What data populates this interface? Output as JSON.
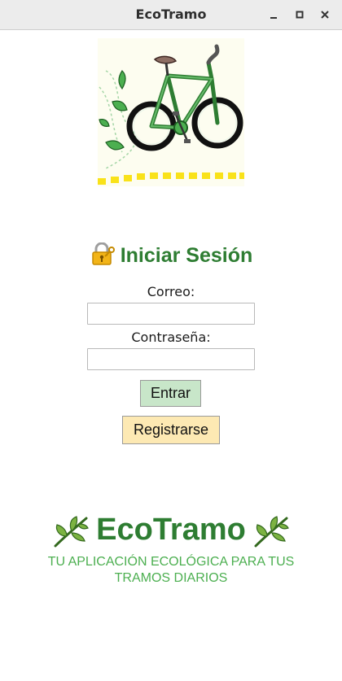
{
  "window": {
    "title": "EcoTramo",
    "controls": [
      "minimize-icon",
      "maximize-icon",
      "close-icon"
    ]
  },
  "login": {
    "icon": "lock-with-key-icon",
    "title": "Iniciar Sesión",
    "email_label": "Correo:",
    "email_value": "",
    "password_label": "Contraseña:",
    "password_value": "",
    "enter_label": "Entrar",
    "register_label": "Registrarse"
  },
  "brand": {
    "name": "EcoTramo",
    "icon": "herb-icon",
    "tagline": "TU APLICACIÓN ECOLÓGICA PARA TUS TRAMOS DIARIOS"
  },
  "colors": {
    "title_green": "#2e7d32",
    "tagline_green": "#4caf50",
    "enter_button_bg": "#c8e6c9",
    "register_button_bg": "#fde9b3"
  }
}
